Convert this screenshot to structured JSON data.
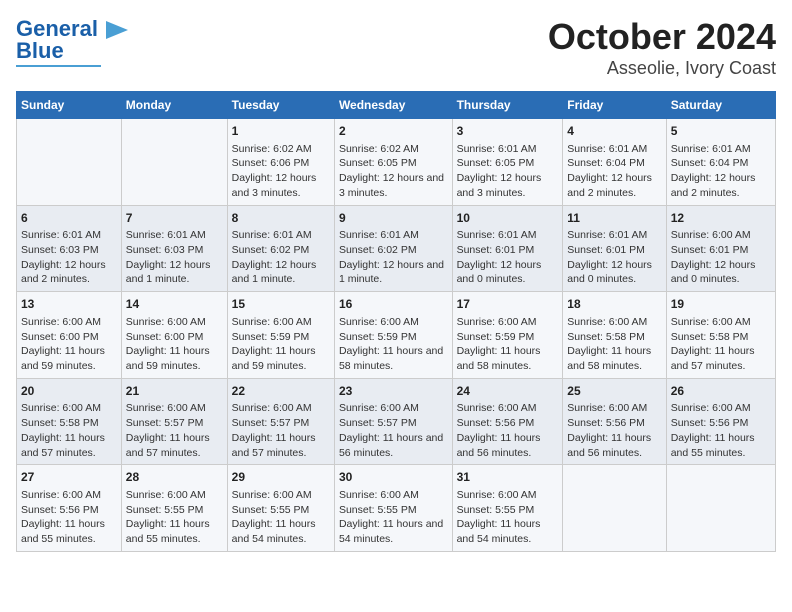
{
  "logo": {
    "line1": "General",
    "line2": "Blue"
  },
  "title": "October 2024",
  "subtitle": "Asseolie, Ivory Coast",
  "weekdays": [
    "Sunday",
    "Monday",
    "Tuesday",
    "Wednesday",
    "Thursday",
    "Friday",
    "Saturday"
  ],
  "weeks": [
    [
      {
        "day": "",
        "content": ""
      },
      {
        "day": "",
        "content": ""
      },
      {
        "day": "1",
        "content": "Sunrise: 6:02 AM\nSunset: 6:06 PM\nDaylight: 12 hours and 3 minutes."
      },
      {
        "day": "2",
        "content": "Sunrise: 6:02 AM\nSunset: 6:05 PM\nDaylight: 12 hours and 3 minutes."
      },
      {
        "day": "3",
        "content": "Sunrise: 6:01 AM\nSunset: 6:05 PM\nDaylight: 12 hours and 3 minutes."
      },
      {
        "day": "4",
        "content": "Sunrise: 6:01 AM\nSunset: 6:04 PM\nDaylight: 12 hours and 2 minutes."
      },
      {
        "day": "5",
        "content": "Sunrise: 6:01 AM\nSunset: 6:04 PM\nDaylight: 12 hours and 2 minutes."
      }
    ],
    [
      {
        "day": "6",
        "content": "Sunrise: 6:01 AM\nSunset: 6:03 PM\nDaylight: 12 hours and 2 minutes."
      },
      {
        "day": "7",
        "content": "Sunrise: 6:01 AM\nSunset: 6:03 PM\nDaylight: 12 hours and 1 minute."
      },
      {
        "day": "8",
        "content": "Sunrise: 6:01 AM\nSunset: 6:02 PM\nDaylight: 12 hours and 1 minute."
      },
      {
        "day": "9",
        "content": "Sunrise: 6:01 AM\nSunset: 6:02 PM\nDaylight: 12 hours and 1 minute."
      },
      {
        "day": "10",
        "content": "Sunrise: 6:01 AM\nSunset: 6:01 PM\nDaylight: 12 hours and 0 minutes."
      },
      {
        "day": "11",
        "content": "Sunrise: 6:01 AM\nSunset: 6:01 PM\nDaylight: 12 hours and 0 minutes."
      },
      {
        "day": "12",
        "content": "Sunrise: 6:00 AM\nSunset: 6:01 PM\nDaylight: 12 hours and 0 minutes."
      }
    ],
    [
      {
        "day": "13",
        "content": "Sunrise: 6:00 AM\nSunset: 6:00 PM\nDaylight: 11 hours and 59 minutes."
      },
      {
        "day": "14",
        "content": "Sunrise: 6:00 AM\nSunset: 6:00 PM\nDaylight: 11 hours and 59 minutes."
      },
      {
        "day": "15",
        "content": "Sunrise: 6:00 AM\nSunset: 5:59 PM\nDaylight: 11 hours and 59 minutes."
      },
      {
        "day": "16",
        "content": "Sunrise: 6:00 AM\nSunset: 5:59 PM\nDaylight: 11 hours and 58 minutes."
      },
      {
        "day": "17",
        "content": "Sunrise: 6:00 AM\nSunset: 5:59 PM\nDaylight: 11 hours and 58 minutes."
      },
      {
        "day": "18",
        "content": "Sunrise: 6:00 AM\nSunset: 5:58 PM\nDaylight: 11 hours and 58 minutes."
      },
      {
        "day": "19",
        "content": "Sunrise: 6:00 AM\nSunset: 5:58 PM\nDaylight: 11 hours and 57 minutes."
      }
    ],
    [
      {
        "day": "20",
        "content": "Sunrise: 6:00 AM\nSunset: 5:58 PM\nDaylight: 11 hours and 57 minutes."
      },
      {
        "day": "21",
        "content": "Sunrise: 6:00 AM\nSunset: 5:57 PM\nDaylight: 11 hours and 57 minutes."
      },
      {
        "day": "22",
        "content": "Sunrise: 6:00 AM\nSunset: 5:57 PM\nDaylight: 11 hours and 57 minutes."
      },
      {
        "day": "23",
        "content": "Sunrise: 6:00 AM\nSunset: 5:57 PM\nDaylight: 11 hours and 56 minutes."
      },
      {
        "day": "24",
        "content": "Sunrise: 6:00 AM\nSunset: 5:56 PM\nDaylight: 11 hours and 56 minutes."
      },
      {
        "day": "25",
        "content": "Sunrise: 6:00 AM\nSunset: 5:56 PM\nDaylight: 11 hours and 56 minutes."
      },
      {
        "day": "26",
        "content": "Sunrise: 6:00 AM\nSunset: 5:56 PM\nDaylight: 11 hours and 55 minutes."
      }
    ],
    [
      {
        "day": "27",
        "content": "Sunrise: 6:00 AM\nSunset: 5:56 PM\nDaylight: 11 hours and 55 minutes."
      },
      {
        "day": "28",
        "content": "Sunrise: 6:00 AM\nSunset: 5:55 PM\nDaylight: 11 hours and 55 minutes."
      },
      {
        "day": "29",
        "content": "Sunrise: 6:00 AM\nSunset: 5:55 PM\nDaylight: 11 hours and 54 minutes."
      },
      {
        "day": "30",
        "content": "Sunrise: 6:00 AM\nSunset: 5:55 PM\nDaylight: 11 hours and 54 minutes."
      },
      {
        "day": "31",
        "content": "Sunrise: 6:00 AM\nSunset: 5:55 PM\nDaylight: 11 hours and 54 minutes."
      },
      {
        "day": "",
        "content": ""
      },
      {
        "day": "",
        "content": ""
      }
    ]
  ]
}
